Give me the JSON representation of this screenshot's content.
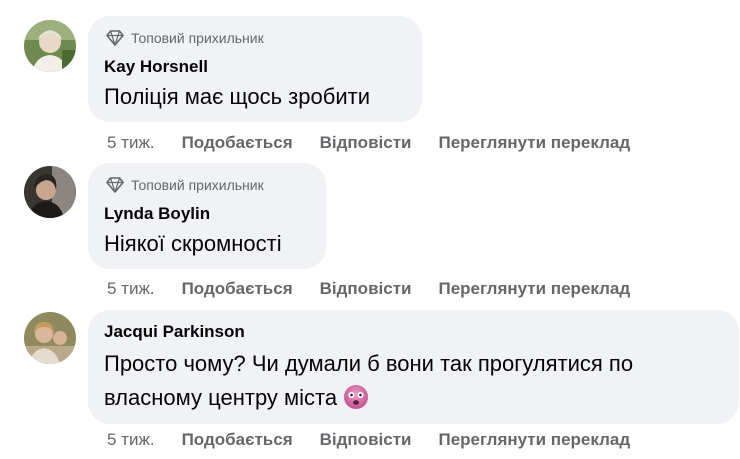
{
  "comments": [
    {
      "badge": "Топовий прихильник",
      "author": "Kay Horsnell",
      "text": "Поліція має щось зробити",
      "time": "5 тиж.",
      "like": "Подобається",
      "reply": "Відповісти",
      "translate": "Переглянути переклад"
    },
    {
      "badge": "Топовий прихильник",
      "author": "Lynda Boylin",
      "text": "Ніякої скромності",
      "time": "5 тиж.",
      "like": "Подобається",
      "reply": "Відповісти",
      "translate": "Переглянути переклад"
    },
    {
      "author": "Jacqui Parkinson",
      "text_line1": "Просто чому? Чи думали б вони так прогулятися по",
      "text_line2": "власному центру міста",
      "emoji": "dizzy-face-emoji",
      "time": "5 тиж.",
      "like": "Подобається",
      "reply": "Відповісти",
      "translate": "Переглянути переклад"
    }
  ],
  "colors": {
    "bubble": "#f0f2f5",
    "secondary_text": "#65676b",
    "primary_text": "#050505"
  }
}
